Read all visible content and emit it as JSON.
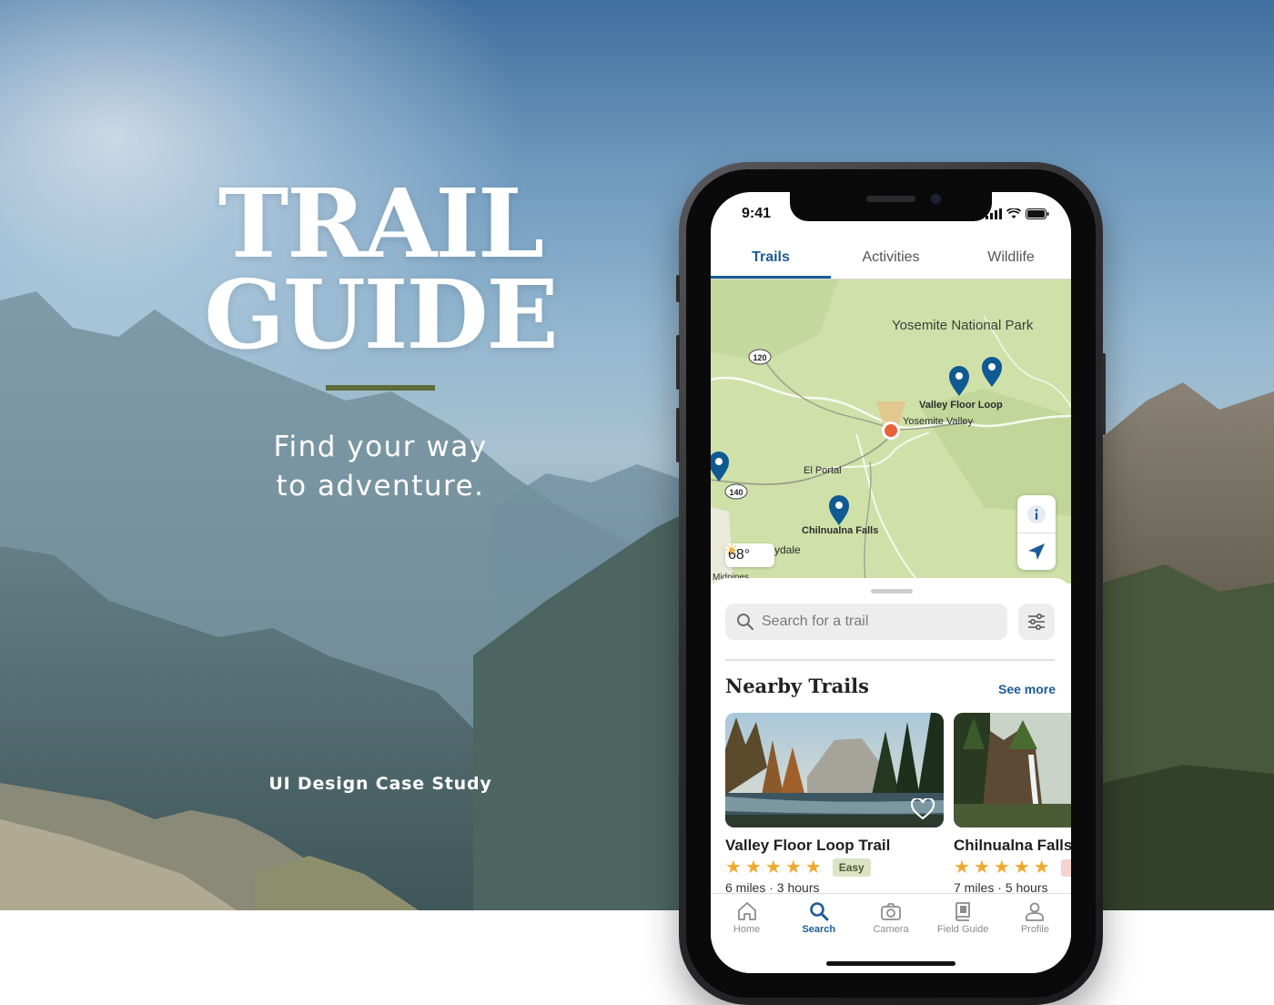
{
  "hero": {
    "title_line1": "TRAIL",
    "title_line2": "GUIDE",
    "tagline_line1": "Find your way",
    "tagline_line2": "to adventure.",
    "case_study": "UI Design Case Study"
  },
  "colors": {
    "accent_blue": "#1c5a96",
    "title_rule_green": "#5b6b3a",
    "pin_blue": "#0f5a93",
    "location_orange": "#e8623a",
    "star_gold": "#f0a92d",
    "map_green": "#cfe0a9"
  },
  "status_bar": {
    "time": "9:41",
    "icons": [
      "signal-icon",
      "wifi-icon",
      "battery-icon"
    ]
  },
  "top_tabs": [
    {
      "label": "Trails",
      "active": true
    },
    {
      "label": "Activities",
      "active": false
    },
    {
      "label": "Wildlife",
      "active": false
    }
  ],
  "map": {
    "park_label": "Yosemite National Park",
    "labels": [
      "Valley Floor Loop",
      "Yosemite Valley",
      "El Portal",
      "Chilnualna Falls",
      "ydale",
      "Midpines"
    ],
    "highway_shields": [
      "120",
      "140"
    ],
    "weather": {
      "temperature": "68°",
      "icon": "sun-icon"
    },
    "controls": [
      "info-icon",
      "location-arrow-icon"
    ]
  },
  "search": {
    "placeholder": "Search for a trail",
    "filter_icon": "sliders-icon"
  },
  "nearby": {
    "title": "Nearby Trails",
    "see_more": "See more",
    "cards": [
      {
        "name": "Valley Floor Loop Trail",
        "stars": 5,
        "difficulty": "Easy",
        "meta": "6 miles · 3 hours",
        "favorite_icon": "heart-icon"
      },
      {
        "name": "Chilnualna Falls",
        "stars": 5,
        "difficulty": "",
        "meta": "7 miles · 5 hours"
      }
    ]
  },
  "tab_bar": [
    {
      "label": "Home",
      "icon": "home-icon",
      "active": false
    },
    {
      "label": "Search",
      "icon": "search-icon",
      "active": true
    },
    {
      "label": "Camera",
      "icon": "camera-icon",
      "active": false
    },
    {
      "label": "Field Guide",
      "icon": "book-icon",
      "active": false
    },
    {
      "label": "Profile",
      "icon": "profile-icon",
      "active": false
    }
  ]
}
